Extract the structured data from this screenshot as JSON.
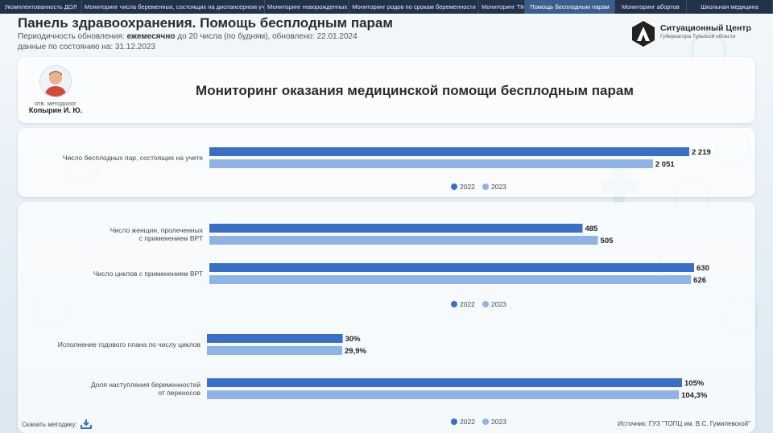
{
  "nav": {
    "tabs": [
      "Укомплектованность ДОЛ",
      "Мониторинг числа беременных, состоящих на диспансерном учете",
      "Мониторинг новорожденных",
      "Мониторинг родов по срокам беременности",
      "Мониторинг ТМК",
      "Помощь бесплодным парам",
      "Мониторинг абортов",
      "Школьная медицина"
    ],
    "active_index": 5
  },
  "header": {
    "title": "Панель здравоохранения. Помощь бесплодным парам",
    "update_label": "Периодичность обновления:",
    "update_freq": "ежемесячно",
    "update_rest": "до 20 числа (по будням), обновлено: 22.01.2024",
    "data_date": "данные по состоянию на: 31.12.2023"
  },
  "logo": {
    "name": "Ситуационный Центр",
    "sub": "Губернатора Тульской области"
  },
  "banner": {
    "person_role": "отв. методолог",
    "person_name": "Копырин И. Ю.",
    "title": "Мониторинг оказания медицинской помощи бесплодным парам"
  },
  "colors": {
    "2022": "#3a6fc4",
    "2023": "#8fb3e3"
  },
  "legend": {
    "a": "2022",
    "b": "2023"
  },
  "chart_data": [
    {
      "type": "bar",
      "orientation": "horizontal",
      "categories": [
        "Число бесплодных пар, состоящих на учете"
      ],
      "series": [
        {
          "name": "2022",
          "values": [
            2219
          ],
          "labels": [
            "2 219"
          ]
        },
        {
          "name": "2023",
          "values": [
            2051
          ],
          "labels": [
            "2 051"
          ]
        }
      ],
      "legend": "bottom"
    },
    {
      "type": "bar",
      "orientation": "horizontal",
      "categories": [
        "Число женщин, пролеченных с применением ВРТ",
        "Число циклов с применением ВРТ"
      ],
      "series": [
        {
          "name": "2022",
          "values": [
            485,
            630
          ],
          "labels": [
            "485",
            "630"
          ]
        },
        {
          "name": "2023",
          "values": [
            505,
            626
          ],
          "labels": [
            "505",
            "626"
          ]
        }
      ],
      "legend": "bottom"
    },
    {
      "type": "bar",
      "orientation": "horizontal",
      "categories": [
        "Исполнение годового плана по числу циклов",
        "Доля наступления беременностей от переносов"
      ],
      "series": [
        {
          "name": "2022",
          "values": [
            30,
            105
          ],
          "labels": [
            "30%",
            "105%"
          ]
        },
        {
          "name": "2023",
          "values": [
            29.9,
            104.3
          ],
          "labels": [
            "29,9%",
            "104,3%"
          ]
        }
      ],
      "legend": "bottom"
    }
  ],
  "footer": {
    "download_label": "Скачать методику:",
    "source": "Источник: ГУЗ \"ТОПЦ им. В.С. Гумилевской\""
  }
}
